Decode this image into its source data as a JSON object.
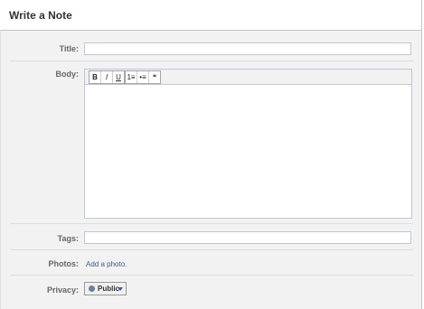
{
  "header": {
    "title": "Write a Note"
  },
  "form": {
    "title_label": "Title:",
    "title_value": "",
    "body_label": "Body:",
    "toolbar": {
      "bold": "B",
      "italic": "I",
      "underline": "U",
      "numbered_list": "1≡",
      "bulleted_list": "•≡",
      "quote": "❝"
    },
    "body_value": "",
    "tags_label": "Tags:",
    "tags_value": "",
    "photos_label": "Photos:",
    "add_photo_link": "Add a photo.",
    "privacy_label": "Privacy:",
    "privacy_value": "Public"
  },
  "colors": {
    "link": "#3b5998",
    "input_border": "#bdc7d8",
    "panel_bg": "#f2f2f2"
  }
}
